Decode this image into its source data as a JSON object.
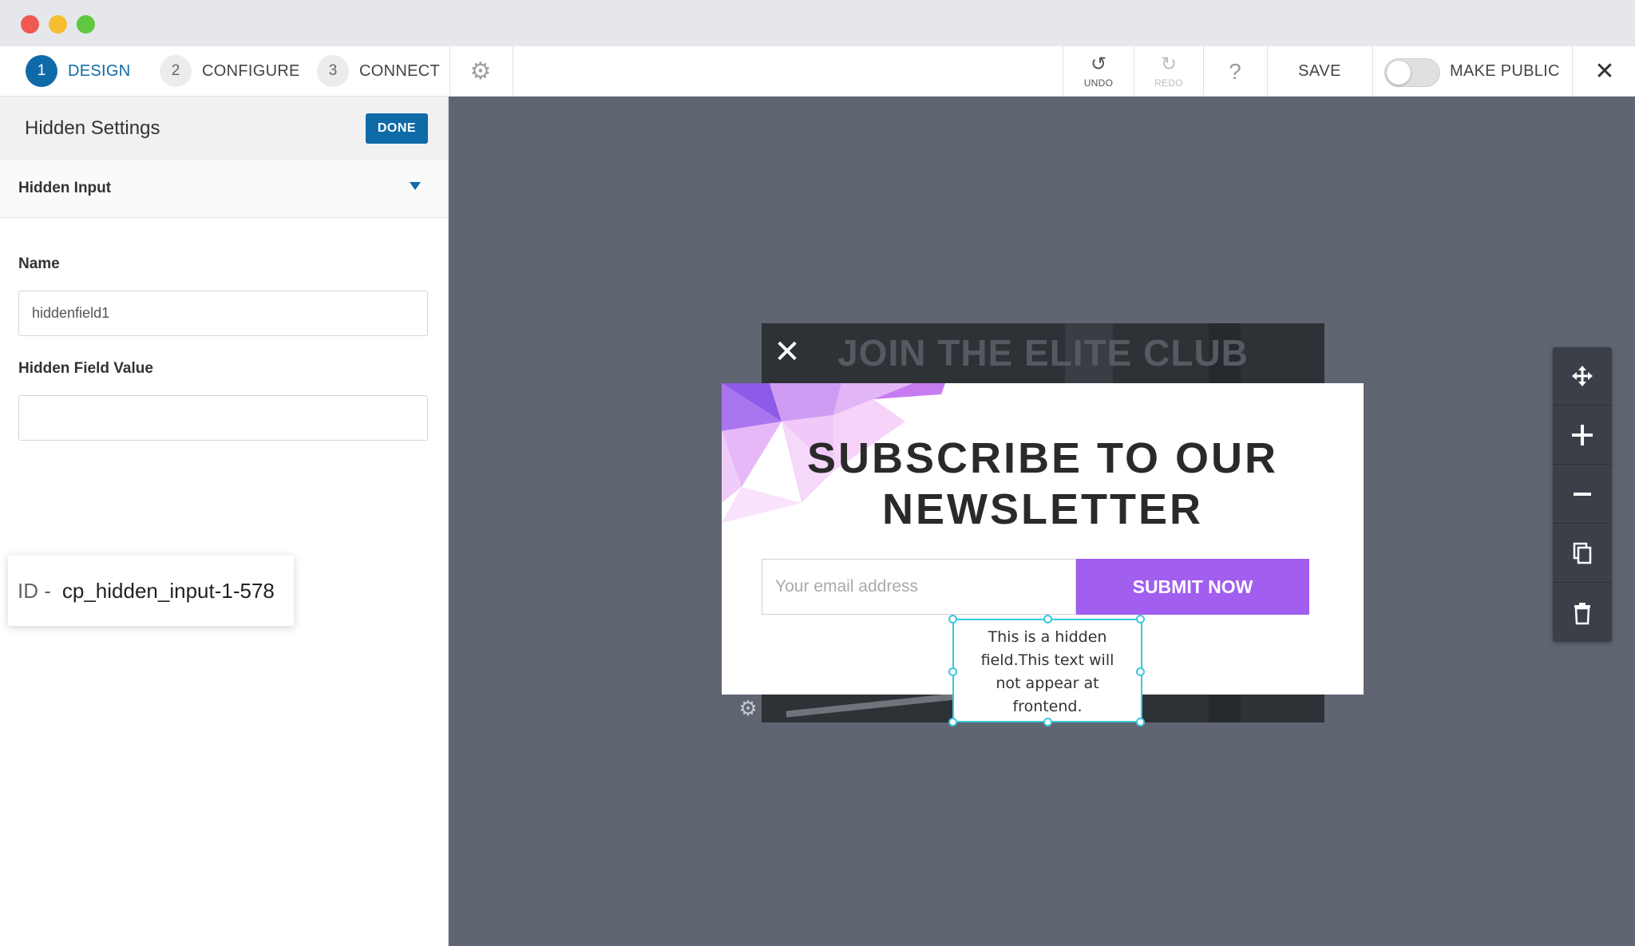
{
  "toolbar": {
    "steps": [
      {
        "num": "1",
        "label": "DESIGN"
      },
      {
        "num": "2",
        "label": "CONFIGURE"
      },
      {
        "num": "3",
        "label": "CONNECT"
      }
    ],
    "undo_label": "UNDO",
    "redo_label": "REDO",
    "help_glyph": "?",
    "save_label": "SAVE",
    "public_label": "MAKE PUBLIC",
    "public_enabled": false,
    "close_glyph": "✕"
  },
  "panel": {
    "title": "Hidden Settings",
    "done_label": "DONE",
    "section_title": "Hidden Input",
    "name_label": "Name",
    "name_value": "hiddenfield1",
    "value_label": "Hidden Field Value",
    "value_value": "",
    "id_prefix": "ID -",
    "id_value": "cp_hidden_input-1-578"
  },
  "popup": {
    "bg_title": "JOIN THE ELITE CLUB",
    "close_glyph": "✕",
    "title_line1": "SUBSCRIBE TO OUR",
    "title_line2": "NEWSLETTER",
    "email_placeholder": "Your email address",
    "submit_label": "SUBMIT NOW",
    "hidden_text_1": "This is a hidden",
    "hidden_text_2": "field.This text will",
    "hidden_text_3": "not appear at",
    "hidden_text_4": "frontend."
  },
  "rail": {
    "tools": [
      "move-icon",
      "plus-icon",
      "minus-icon",
      "duplicate-icon",
      "trash-icon"
    ]
  },
  "colors": {
    "accent": "#0f6aa8",
    "submit": "#a15eef",
    "canvas": "#5f6672",
    "selection": "#3cc6df"
  }
}
